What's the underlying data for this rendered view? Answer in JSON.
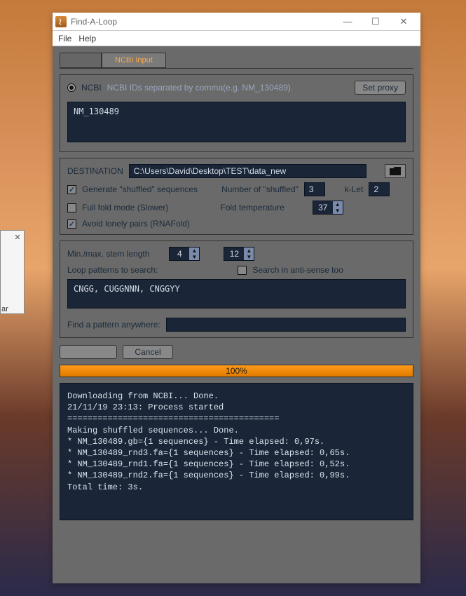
{
  "window": {
    "title": "Find-A-Loop"
  },
  "menu": {
    "file": "File",
    "help": "Help"
  },
  "tabs": {
    "blank_label": "",
    "ncbi_input": "NCBI Input"
  },
  "source": {
    "radio_label": "NCBI",
    "hint": "NCBI IDs separated by comma(e.g. NM_130489).",
    "set_proxy": "Set proxy",
    "ids_value": "NM_130489"
  },
  "dest": {
    "label": "DESTINATION",
    "path": "C:\\Users\\David\\Desktop\\TEST\\data_new",
    "gen_shuffled": "Generate \"shuffled\" sequences",
    "num_shuffled_label": "Number of \"shuffled\"",
    "num_shuffled_value": "3",
    "klet_label": "k-Let",
    "klet_value": "2",
    "full_fold": "Full fold mode (Slower)",
    "fold_temp_label": "Fold temperature",
    "fold_temp_value": "37",
    "avoid_lonely": "Avoid lonely pairs (RNAFold)"
  },
  "search": {
    "stem_label": "Min./max. stem length",
    "stem_min": "4",
    "stem_max": "12",
    "patterns_label": "Loop patterns to search:",
    "antisense_label": "Search in anti-sense too",
    "patterns_value": "CNGG, CUGGNNN, CNGGYY",
    "anywhere_label": "Find a pattern anywhere:",
    "anywhere_value": ""
  },
  "actions": {
    "run": "",
    "cancel": "Cancel",
    "progress": "100%"
  },
  "console": {
    "lines": [
      "Downloading from NCBI... Done.",
      "21/11/19 23:13: Process started",
      "==========================================",
      "Making shuffled sequences... Done.",
      "* NM_130489.gb={1 sequences} - Time elapsed: 0,97s.",
      "* NM_130489_rnd3.fa={1 sequences} - Time elapsed: 0,65s.",
      "* NM_130489_rnd1.fa={1 sequences} - Time elapsed: 0,52s.",
      "* NM_130489_rnd2.fa={1 sequences} - Time elapsed: 0,99s.",
      "Total time: 3s."
    ]
  },
  "bg": {
    "ar": "ar"
  }
}
